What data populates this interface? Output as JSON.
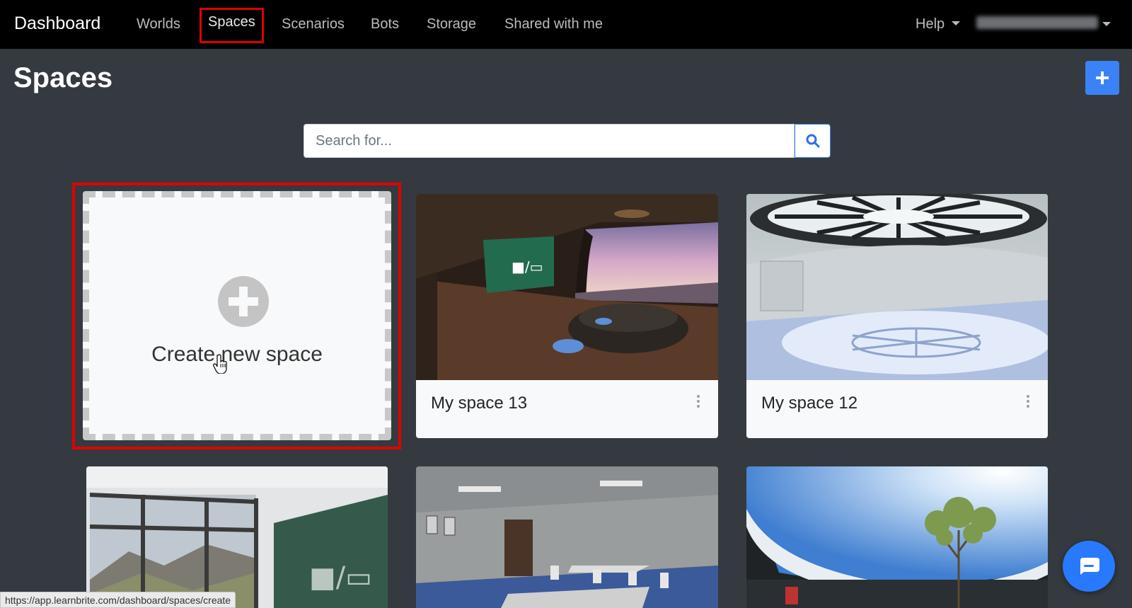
{
  "nav": {
    "brand": "Dashboard",
    "items": [
      {
        "label": "Worlds"
      },
      {
        "label": "Spaces",
        "active": true
      },
      {
        "label": "Scenarios"
      },
      {
        "label": "Bots"
      },
      {
        "label": "Storage"
      },
      {
        "label": "Shared with me"
      }
    ],
    "help_label": "Help"
  },
  "page": {
    "title": "Spaces"
  },
  "search": {
    "placeholder": "Search for...",
    "icon": "search-icon"
  },
  "create_card": {
    "label": "Create new space",
    "icon": "plus-circle-icon"
  },
  "cards": [
    {
      "title": "My space 13"
    },
    {
      "title": "My space 12"
    }
  ],
  "status_bar": {
    "url": "https://app.learnbrite.com/dashboard/spaces/create"
  },
  "colors": {
    "navbar_bg": "#000000",
    "page_bg": "#343a40",
    "accent": "#3b82f6",
    "highlight": "#e00000"
  }
}
